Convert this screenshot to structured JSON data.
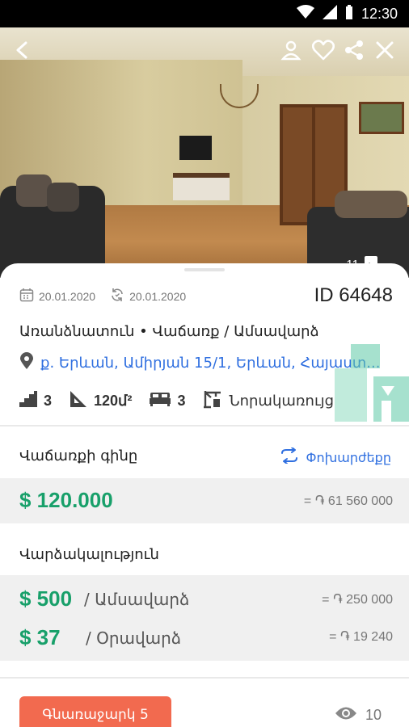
{
  "status_bar": {
    "time": "12:30"
  },
  "hero": {
    "photo_count": "11",
    "back_icon": "arrow-back-icon",
    "actions": [
      "person-pin-icon",
      "heart-icon",
      "share-icon",
      "close-icon"
    ]
  },
  "listing": {
    "created_date": "20.01.2020",
    "updated_date": "20.01.2020",
    "id_label": "ID 64648",
    "title": "Առանձնատուն • Վաճառք / Ամսավարձ",
    "address": "ք. Երևան, Ամիրյան 15/1, Երևան, Հայաստ...",
    "features": {
      "floors": "3",
      "area": "120մ²",
      "bedrooms": "3",
      "building_type": "Նորակառույց"
    }
  },
  "sale": {
    "title": "Վաճառքի գինը",
    "convert_label": "Փոխարժեքը",
    "price_usd": "$ 120.000",
    "price_amd": "= ֏ 61 560 000"
  },
  "rent": {
    "title": "Վարձակալություն",
    "monthly_usd": "$ 500",
    "monthly_unit": "/ Ամսավարձ",
    "monthly_amd": "= ֏ 250 000",
    "daily_usd": "$ 37",
    "daily_unit": "/ Օրավարձ",
    "daily_amd": "= ֏ 19 240"
  },
  "footer": {
    "offer_label": "Գնառաջարկ 5",
    "views": "10"
  },
  "colors": {
    "accent_green": "#18a06a",
    "link_blue": "#2f6fe0",
    "offer_orange": "#f26a4f",
    "band_gray": "#f0f0f0"
  }
}
